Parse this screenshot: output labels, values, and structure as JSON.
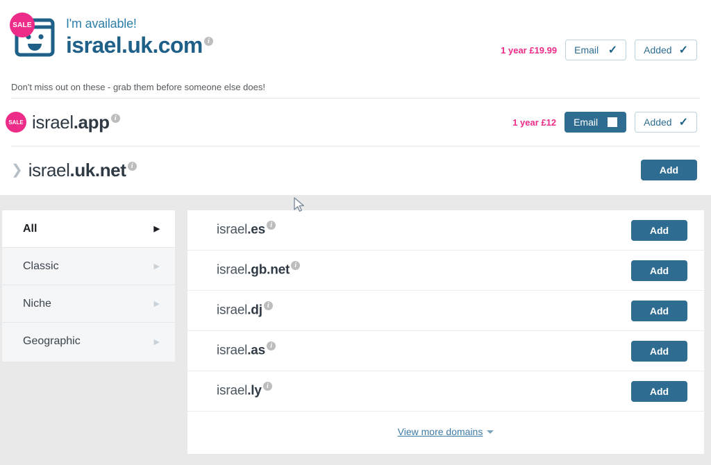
{
  "hero": {
    "badge": "SALE",
    "icon": "browser-smiley-icon",
    "available_label": "I'm available!",
    "domain": "israel.uk.com",
    "info_icon": "i",
    "price": "1 year £19.99",
    "email_button": "Email",
    "email_state": "checked",
    "added_button": "Added",
    "added_state": "checked"
  },
  "subtitle": "Don't miss out on these - grab them before someone else does!",
  "offer_rows": [
    {
      "badge": "SALE",
      "name_prefix": "israel",
      "name_tld": ".app",
      "info_icon": "i",
      "price": "1 year £12",
      "email_button": "Email",
      "email_state": "unchecked",
      "added_button": "Added",
      "added_state": "checked"
    },
    {
      "badge": "",
      "expander_icon": "chevron-right-icon",
      "name_prefix": "israel",
      "name_tld": ".uk.net",
      "info_icon": "i",
      "add_button": "Add"
    }
  ],
  "categories": [
    {
      "label": "All",
      "active": true,
      "arrow": "▶"
    },
    {
      "label": "Classic",
      "active": false,
      "arrow": "▶"
    },
    {
      "label": "Niche",
      "active": false,
      "arrow": "▶"
    },
    {
      "label": "Geographic",
      "active": false,
      "arrow": "▶"
    }
  ],
  "domain_list": [
    {
      "prefix": "israel",
      "tld": ".es",
      "info_icon": "i",
      "add_button": "Add"
    },
    {
      "prefix": "israel",
      "tld": ".gb.net",
      "info_icon": "i",
      "add_button": "Add"
    },
    {
      "prefix": "israel",
      "tld": ".dj",
      "info_icon": "i",
      "add_button": "Add"
    },
    {
      "prefix": "israel",
      "tld": ".as",
      "info_icon": "i",
      "add_button": "Add"
    },
    {
      "prefix": "israel",
      "tld": ".ly",
      "info_icon": "i",
      "add_button": "Add"
    }
  ],
  "footer": {
    "view_more": "View more domains",
    "caret": "chevron-down-icon"
  },
  "colors": {
    "pink": "#ED2B88",
    "blue": "#2E6C91",
    "dark_blue": "#1F6089",
    "grey_bg": "#e9e9e9",
    "sidebar_bg": "#f4f6f8"
  }
}
